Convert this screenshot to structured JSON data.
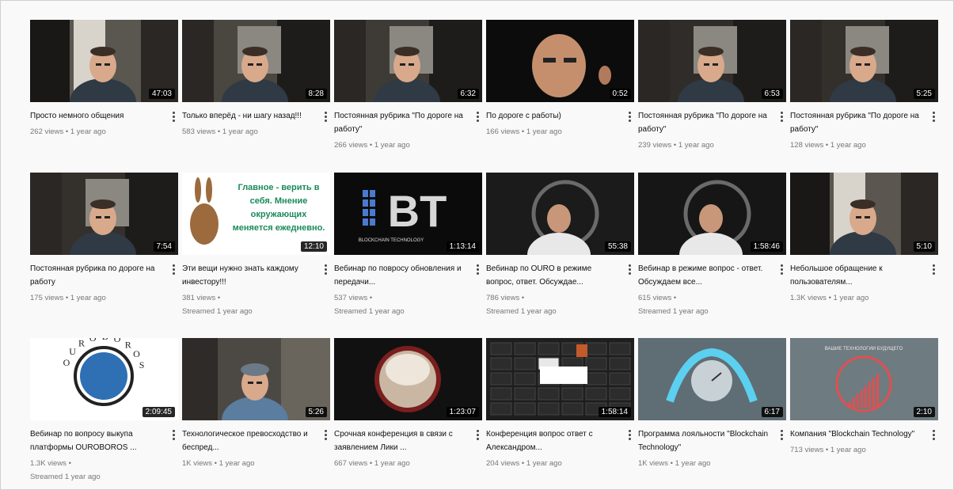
{
  "videos": [
    {
      "title": "Просто немного общения",
      "views": "262 views",
      "age": "1 year ago",
      "duration": "47:03",
      "scene": "office",
      "bg": "#5a5650"
    },
    {
      "title": "Только вперёд - ни шагу назад!!!",
      "views": "583 views",
      "age": "1 year ago",
      "duration": "8:28",
      "scene": "car",
      "bg": "#4a4640"
    },
    {
      "title": "Постоянная рубрика \"По дороге на работу\"",
      "views": "266 views",
      "age": "1 year ago",
      "duration": "6:32",
      "scene": "car",
      "bg": "#3e3b36"
    },
    {
      "title": "По дороге с работы)",
      "views": "166 views",
      "age": "1 year ago",
      "duration": "0:52",
      "scene": "dark-face",
      "bg": "#0c0c0c"
    },
    {
      "title": "Постоянная рубрика \"По дороге на работу\"",
      "views": "239 views",
      "age": "1 year ago",
      "duration": "6:53",
      "scene": "car",
      "bg": "#2f2c29"
    },
    {
      "title": "Постоянная рубрика \"По дороге на работу\"",
      "views": "128 views",
      "age": "1 year ago",
      "duration": "5:25",
      "scene": "car",
      "bg": "#33302c"
    },
    {
      "title": "Постоянная рубрика по дороге на работу",
      "views": "175 views",
      "age": "1 year ago",
      "duration": "7:54",
      "scene": "car",
      "bg": "#34312d"
    },
    {
      "title": "Эти вещи нужно знать каждому инвестору!!!",
      "views": "381 views",
      "age": "Streamed 1 year ago",
      "duration": "12:10",
      "scene": "quote",
      "bg": "#ffffff",
      "quote_text": [
        "Главное - верить в",
        "себя. Мнение",
        "окружающих",
        "меняется ежедневно."
      ]
    },
    {
      "title": "Вебинар по повросу обновления и передачи...",
      "views": "537 views",
      "age": "Streamed 1 year ago",
      "duration": "1:13:14",
      "scene": "bt-logo",
      "bg": "#0b0b0b",
      "logo_text": "BT",
      "logo_sub": "BLOCKCHAIN TECHNOLOGY"
    },
    {
      "title": "Вебинар по OURO в режиме вопрос, ответ. Обсуждае...",
      "views": "786 views",
      "age": "Streamed 1 year ago",
      "duration": "55:38",
      "scene": "studio",
      "bg": "#1b1b1b"
    },
    {
      "title": "Вебинар в режиме вопрос - ответ. Обсуждаем все...",
      "views": "615 views",
      "age": "Streamed 1 year ago",
      "duration": "1:58:46",
      "scene": "studio",
      "bg": "#161616"
    },
    {
      "title": "Небольшое обращение к пользователям...",
      "views": "1.3K views",
      "age": "1 year ago",
      "duration": "5:10",
      "scene": "office",
      "bg": "#5b5750"
    },
    {
      "title": "Вебинар по вопросу выкупа платформы OUROBOROS ...",
      "views": "1.3K views",
      "age": "Streamed 1 year ago",
      "duration": "2:09:45",
      "scene": "ouroboros",
      "bg": "#ffffff",
      "logo_text": "OUROBOROS"
    },
    {
      "title": "Технологическое превосходство и беспред...",
      "views": "1K views",
      "age": "1 year ago",
      "duration": "5:26",
      "scene": "cap",
      "bg": "#4c4944"
    },
    {
      "title": "Срочная конференция в связи с заявлением Лики ...",
      "views": "667 views",
      "age": "1 year ago",
      "duration": "1:23:07",
      "scene": "portrait",
      "bg": "#111111"
    },
    {
      "title": "Конференция вопрос ответ с Александром...",
      "views": "204 views",
      "age": "1 year ago",
      "duration": "1:58:14",
      "scene": "conference",
      "bg": "#1e1e1e"
    },
    {
      "title": "Программа лояльности \"Blockchain Technology\"",
      "views": "1K views",
      "age": "1 year ago",
      "duration": "6:17",
      "scene": "clock",
      "bg": "#5f6e74"
    },
    {
      "title": "Компания \"Blockchain Technology\"",
      "views": "713 views",
      "age": "1 year ago",
      "duration": "2:10",
      "scene": "growth",
      "bg": "#6e7b80",
      "logo_text": "ВАШИЕ ТЕХНОЛОГИИ БУДУЩЕГО"
    }
  ]
}
